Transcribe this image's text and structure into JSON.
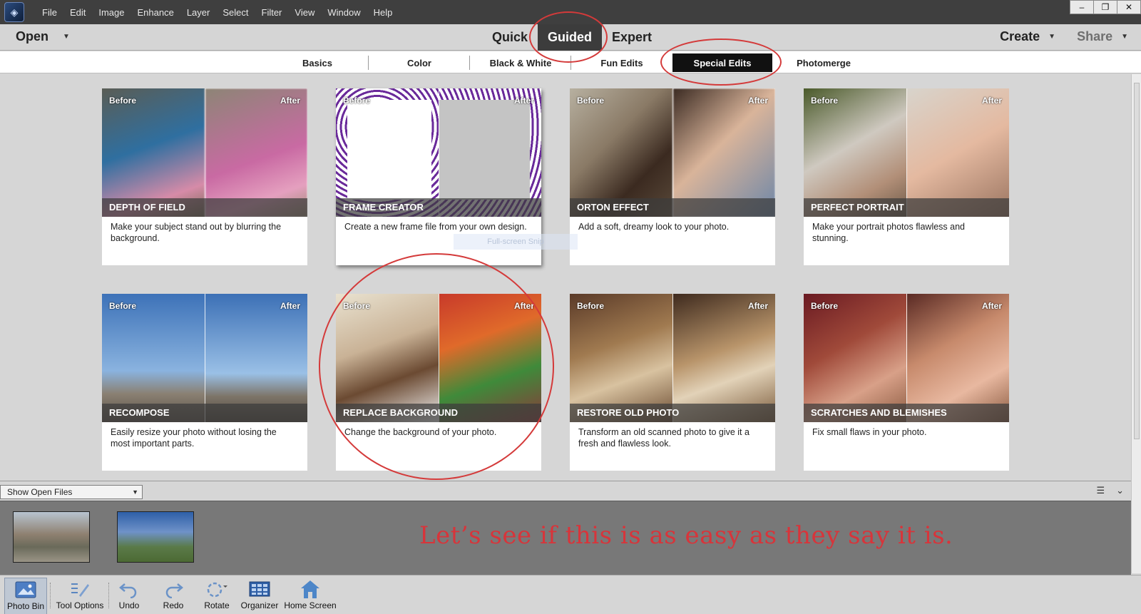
{
  "menubar": {
    "items": [
      "File",
      "Edit",
      "Image",
      "Enhance",
      "Layer",
      "Select",
      "Filter",
      "View",
      "Window",
      "Help"
    ],
    "controls": [
      "–",
      "❐",
      "✕"
    ]
  },
  "modebar": {
    "open_label": "Open",
    "modes": [
      "Quick",
      "Guided",
      "Expert"
    ],
    "active_mode": "Guided",
    "create_label": "Create",
    "share_label": "Share"
  },
  "subtabs": {
    "items": [
      "Basics",
      "Color",
      "Black & White",
      "Fun Edits",
      "Special Edits",
      "Photomerge"
    ],
    "active": "Special Edits"
  },
  "cards": {
    "before_label": "Before",
    "after_label": "After",
    "items": [
      {
        "title": "DEPTH OF FIELD",
        "desc": "Make your subject stand out by blurring the background."
      },
      {
        "title": "FRAME CREATOR",
        "desc": "Create a new frame file from your own design."
      },
      {
        "title": "ORTON EFFECT",
        "desc": "Add a soft, dreamy look to your photo."
      },
      {
        "title": "PERFECT PORTRAIT",
        "desc": "Make your portrait photos flawless and stunning."
      },
      {
        "title": "RECOMPOSE",
        "desc": "Easily resize your photo without losing the most important parts."
      },
      {
        "title": "REPLACE BACKGROUND",
        "desc": "Change the background of your photo."
      },
      {
        "title": "RESTORE OLD PHOTO",
        "desc": "Transform an old scanned photo to give it a fresh and flawless look."
      },
      {
        "title": "SCRATCHES AND BLEMISHES",
        "desc": "Fix small flaws in your photo."
      }
    ]
  },
  "overlay": {
    "snip_text": "Full-screen Snip"
  },
  "photobin": {
    "select_value": "Show Open Files",
    "annotation": "Let’s see if this is as easy as they say it is."
  },
  "toolbar": {
    "items": [
      "Photo Bin",
      "Tool Options",
      "Undo",
      "Redo",
      "Rotate",
      "Organizer",
      "Home Screen"
    ]
  },
  "colors": {
    "accent_red": "#d43a3a",
    "active_tab": "#111111"
  }
}
